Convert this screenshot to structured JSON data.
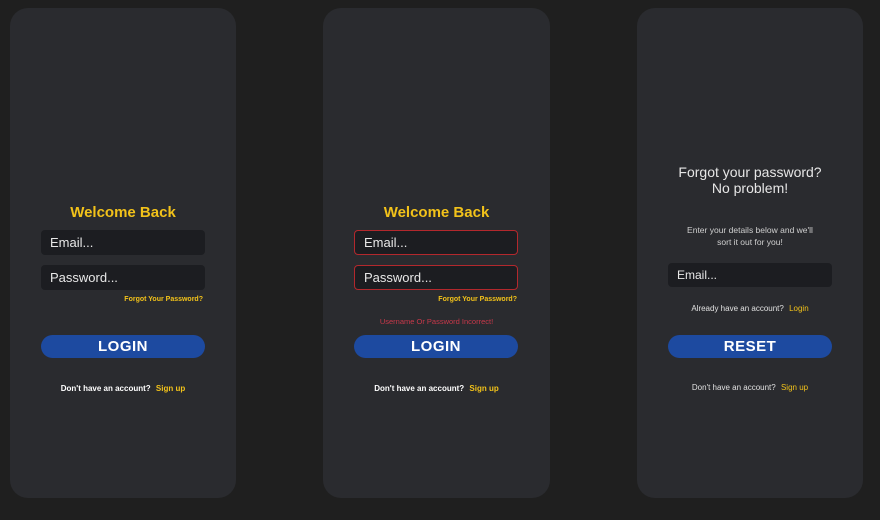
{
  "screens": [
    {
      "title": "Welcome Back",
      "email_placeholder": "Email...",
      "password_placeholder": "Password...",
      "forgot_link": "Forgot Your Password?",
      "login_button": "LOGIN",
      "footer_text": "Don't have an account?",
      "signup_link": "Sign up"
    },
    {
      "title": "Welcome Back",
      "email_placeholder": "Email...",
      "password_placeholder": "Password...",
      "forgot_link": "Forgot Your Password?",
      "error_message": "Username Or Password Incorrect!",
      "login_button": "LOGIN",
      "footer_text": "Don't have an account?",
      "signup_link": "Sign up"
    },
    {
      "heading_line1": "Forgot your password?",
      "heading_line2": "No problem!",
      "description_line1": "Enter your details below and we'll",
      "description_line2": "sort it out for you!",
      "email_placeholder": "Email...",
      "already_text": "Already have an account?",
      "login_link": "Login",
      "reset_button": "RESET",
      "footer_text": "Don't have an account?",
      "signup_link": "Sign up"
    }
  ],
  "colors": {
    "background": "#1f1f1f",
    "card": "#2a2b2f",
    "accent_yellow": "#f2c21a",
    "button_blue": "#1d4aa0",
    "error_red": "#c8384a"
  }
}
